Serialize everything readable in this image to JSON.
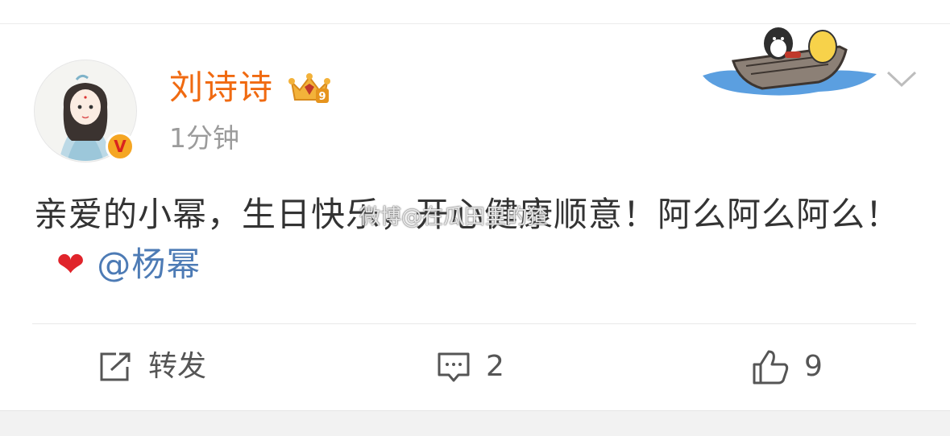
{
  "post": {
    "username": "刘诗诗",
    "timestamp": "1分钟",
    "text_part1": "亲爱的小幂，生日快乐，开心健康顺意！阿么阿么阿么！",
    "heart_emoji": "❤",
    "mention": "@杨幂",
    "watermark": "微博@在瓜田里的猹",
    "verified_badge": "V",
    "crown_badge_number": "9"
  },
  "actions": {
    "repost_label": "转发",
    "comment_count": "2",
    "like_count": "9"
  },
  "colors": {
    "username": "#f06a11",
    "mention": "#4d7bb5",
    "timestamp": "#9b9b9b",
    "badge": "#f5a623",
    "heart": "#e0242b"
  },
  "icons": [
    "avatar-illustration",
    "verified-badge-icon",
    "crown-vip-icon",
    "boat-decoration-icon",
    "chevron-down-icon",
    "repost-icon",
    "comment-icon",
    "like-icon"
  ]
}
